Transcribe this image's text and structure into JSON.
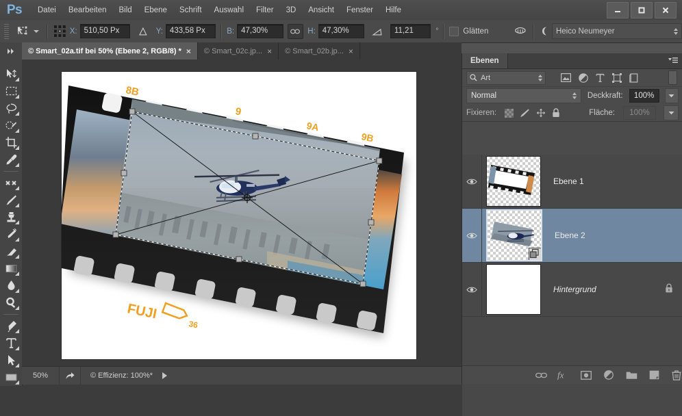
{
  "app": {
    "logo": "Ps",
    "window_controls": [
      "minimize",
      "maximize",
      "close"
    ]
  },
  "menubar": {
    "items": [
      "Datei",
      "Bearbeiten",
      "Bild",
      "Ebene",
      "Schrift",
      "Auswahl",
      "Filter",
      "3D",
      "Ansicht",
      "Fenster",
      "Hilfe"
    ]
  },
  "options_bar": {
    "tool_icon": "free-transform-icon",
    "reference_point_icon": "reference-point-grid-icon",
    "fields": [
      {
        "label": "X:",
        "value": "510,50 Px"
      },
      {
        "label": "Y:",
        "value": "433,58 Px"
      },
      {
        "label": "B:",
        "value": "47,30%"
      },
      {
        "label": "H:",
        "value": "47,30%"
      }
    ],
    "delta_icon": "delta-triangle-icon",
    "link_icon": "link-chain-icon",
    "skew_icon": "skew-angle-icon",
    "angle_value": "11,21",
    "degree_symbol": "°",
    "interpolation_label": "Glätten",
    "warp_icon": "warp-mode-icon",
    "workspace_icon": "workspace-moon-icon",
    "workspace_name": "Heico Neumeyer"
  },
  "tabs": {
    "collapse_icon": "double-chevron-right-icon",
    "items": [
      {
        "title": "© Smart_02a.tif bei 50% (Ebene 2, RGB/8) *",
        "active": true,
        "close": "×"
      },
      {
        "title": "© Smart_02c.jp...",
        "active": false,
        "close": "×"
      },
      {
        "title": "© Smart_02b.jp...",
        "active": false,
        "close": "×"
      }
    ]
  },
  "toolbar": {
    "tools": [
      {
        "name": "move-tool-icon"
      },
      {
        "name": "rectangular-marquee-tool-icon"
      },
      {
        "name": "lasso-tool-icon"
      },
      {
        "name": "quick-selection-tool-icon"
      },
      {
        "name": "crop-tool-icon"
      },
      {
        "name": "eyedropper-tool-icon"
      },
      {
        "name": "healing-brush-tool-icon"
      },
      {
        "name": "brush-tool-icon"
      },
      {
        "name": "clone-stamp-tool-icon"
      },
      {
        "name": "history-brush-tool-icon"
      },
      {
        "name": "eraser-tool-icon"
      },
      {
        "name": "gradient-tool-icon"
      },
      {
        "name": "blur-tool-icon"
      },
      {
        "name": "dodge-tool-icon"
      },
      {
        "name": "pen-tool-icon"
      },
      {
        "name": "type-tool-icon"
      },
      {
        "name": "path-selection-tool-icon"
      },
      {
        "name": "rectangle-tool-icon"
      }
    ]
  },
  "canvas": {
    "film_labels": [
      "8B",
      "9",
      "9A",
      "9B"
    ],
    "brand_label": "FUJI",
    "exposure_count": "36",
    "subject": "helicopter-over-city-photo"
  },
  "status_bar": {
    "zoom": "50%",
    "share_icon": "share-arrow-icon",
    "info": "© Effizienz: 100%*",
    "expand_icon": "play-arrow-icon"
  },
  "layers_panel": {
    "tab_title": "Ebenen",
    "menu_icon": "panel-menu-icon",
    "filter": {
      "search_icon": "search-icon",
      "kind_label": "Art",
      "icons": [
        "pixel-filter-icon",
        "adjustment-filter-icon",
        "type-filter-icon",
        "shape-filter-icon",
        "smart-object-filter-icon"
      ],
      "toggle_icon": "filter-power-toggle-icon"
    },
    "blend_mode": "Normal",
    "opacity_label": "Deckkraft:",
    "opacity_value": "100%",
    "lock_label": "Fixieren:",
    "lock_icons": [
      "lock-transparency-icon",
      "lock-image-pixels-icon",
      "lock-position-icon",
      "lock-all-icon"
    ],
    "fill_label": "Fläche:",
    "fill_value": "100%",
    "layers": [
      {
        "name": "Ebene 1",
        "visible": true,
        "selected": false,
        "locked": false,
        "italic": false,
        "thumb": "filmstrip-thumbnail",
        "smart": false
      },
      {
        "name": "Ebene 2",
        "visible": true,
        "selected": true,
        "locked": false,
        "italic": false,
        "thumb": "helicopter-thumbnail",
        "smart": true
      },
      {
        "name": "Hintergrund",
        "visible": true,
        "selected": false,
        "locked": true,
        "italic": true,
        "thumb": "white-thumbnail",
        "smart": false
      }
    ],
    "bottom_icons": [
      "link-layers-icon",
      "layer-style-fx-icon",
      "add-layer-mask-icon",
      "new-adjustment-layer-icon",
      "new-group-icon",
      "new-layer-icon",
      "delete-layer-icon"
    ]
  },
  "colors": {
    "chrome": "#4a4a4a",
    "panel": "#4b4b4b",
    "selection_blue": "#6f87a0",
    "accent_label": "#8aa9c6"
  }
}
